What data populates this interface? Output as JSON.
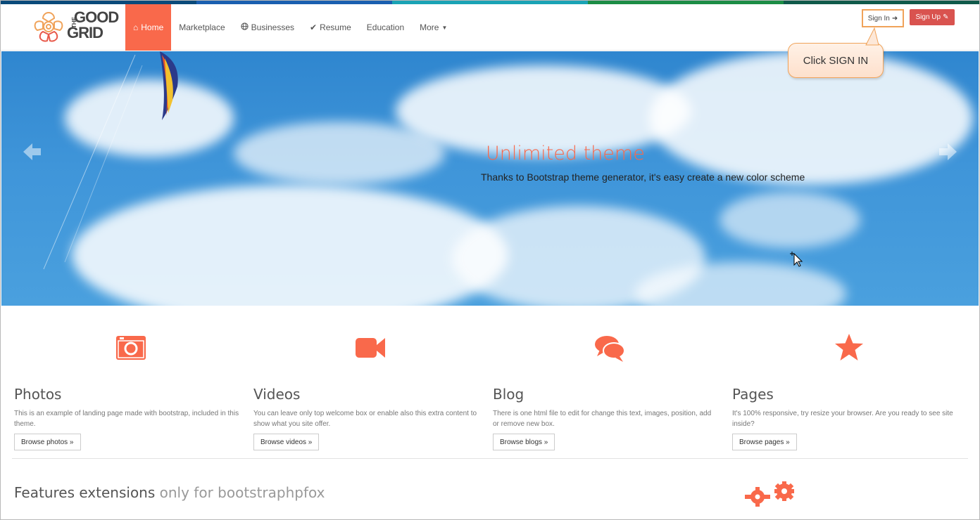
{
  "stripe_colors": [
    "#0a4a7a",
    "#1a5fb0",
    "#1aa3b5",
    "#1c8d45",
    "#0f5a4a"
  ],
  "brand": {
    "logo_line1": "THE",
    "logo_line2": "GOOD",
    "logo_line3": "GRID",
    "accent": "#f9694b"
  },
  "nav": {
    "items": [
      {
        "label": "Home",
        "icon": "home-icon",
        "active": true
      },
      {
        "label": "Marketplace"
      },
      {
        "label": "Businesses",
        "icon": "globe-icon"
      },
      {
        "label": "Resume",
        "icon": "check-icon"
      },
      {
        "label": "Education"
      },
      {
        "label": "More",
        "icon": "caret-down-icon"
      }
    ],
    "sign_in": "Sign In",
    "sign_up": "Sign Up"
  },
  "callout": {
    "text": "Click SIGN IN"
  },
  "hero": {
    "title": "Unlimited theme",
    "subtitle": "Thanks to Bootstrap theme generator, it's easy create a new color scheme"
  },
  "features": [
    {
      "icon": "camera-icon",
      "title": "Photos",
      "text": "This is an example of landing page made with bootstrap, included in this theme.",
      "button": "Browse photos »"
    },
    {
      "icon": "video-camera-icon",
      "title": "Videos",
      "text": "You can leave only top welcome box or enable also this extra content to show what you site offer.",
      "button": "Browse videos »"
    },
    {
      "icon": "comments-icon",
      "title": "Blog",
      "text": "There is one html file to edit for change this text, images, position, add or remove new box.",
      "button": "Browse blogs »"
    },
    {
      "icon": "star-icon",
      "title": "Pages",
      "text": "It's 100% responsive, try resize your browser. Are you ready to see site inside?",
      "button": "Browse pages »"
    }
  ],
  "extensions": {
    "title_main": "Features extensions",
    "title_muted": "only for bootstraphpfox"
  }
}
